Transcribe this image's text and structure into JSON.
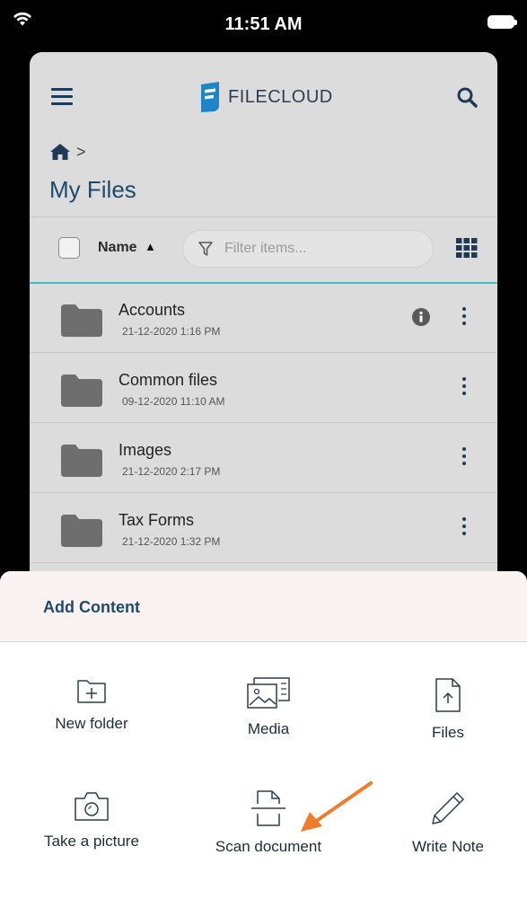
{
  "status_bar": {
    "time": "11:51 AM"
  },
  "header": {
    "logo_text": "FILECLOUD"
  },
  "breadcrumb": {
    "separator": ">"
  },
  "page_title": "My Files",
  "sort_bar": {
    "sort_label": "Name",
    "sort_arrow": "▲",
    "filter_placeholder": "Filter items..."
  },
  "files": [
    {
      "name": "Accounts",
      "date": "21-12-2020 1:16 PM",
      "has_info": true
    },
    {
      "name": "Common files",
      "date": "09-12-2020 11:10 AM",
      "has_info": false
    },
    {
      "name": "Images",
      "date": "21-12-2020 2:17 PM",
      "has_info": false
    },
    {
      "name": "Tax Forms",
      "date": "21-12-2020 1:32 PM",
      "has_info": false
    }
  ],
  "add_content": {
    "title": "Add Content",
    "actions": [
      {
        "label": "New folder",
        "icon": "new-folder-icon"
      },
      {
        "label": "Media",
        "icon": "media-icon"
      },
      {
        "label": "Files",
        "icon": "file-upload-icon"
      },
      {
        "label": "Take a picture",
        "icon": "camera-icon"
      },
      {
        "label": "Scan document",
        "icon": "scan-document-icon"
      },
      {
        "label": "Write Note",
        "icon": "pencil-icon"
      }
    ]
  },
  "colors": {
    "accent": "#3cbfc2",
    "brand": "#1e4a6e",
    "annotation_arrow": "#f07b2a"
  }
}
